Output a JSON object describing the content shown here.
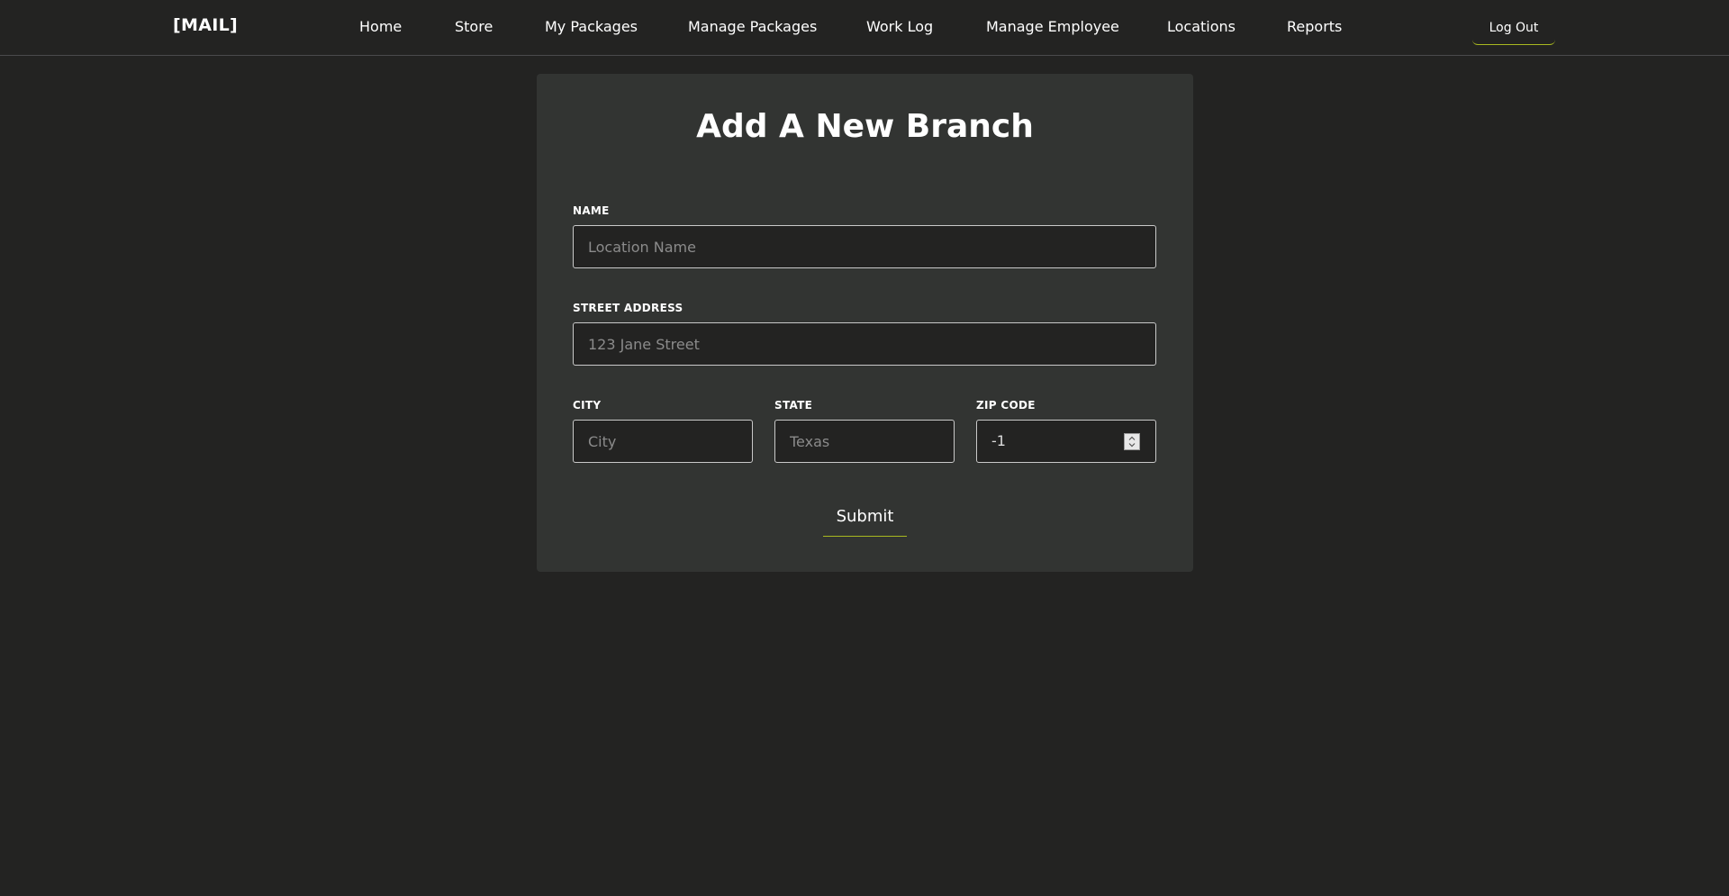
{
  "brand": "[MAIL]",
  "nav": {
    "home": "Home",
    "store": "Store",
    "my_packages": "My Packages",
    "manage_packages": "Manage Packages",
    "work_log": "Work Log",
    "manage_employee": "Manage Employee",
    "locations": "Locations",
    "reports": "Reports",
    "logout": "Log Out"
  },
  "form": {
    "title": "Add A New Branch",
    "name": {
      "label": "NAME",
      "placeholder": "Location Name",
      "value": ""
    },
    "street": {
      "label": "STREET ADDRESS",
      "placeholder": "123 Jane Street",
      "value": ""
    },
    "city": {
      "label": "CITY",
      "placeholder": "City",
      "value": ""
    },
    "state": {
      "label": "STATE",
      "placeholder": "Texas",
      "value": ""
    },
    "zip": {
      "label": "ZIP CODE",
      "value": "-1",
      "spinner_icon": "number-stepper-icon"
    },
    "submit_label": "Submit"
  },
  "colors": {
    "background": "#232322",
    "card": "#323432",
    "accent_underline": "#a8b820",
    "text": "#ffffff",
    "placeholder": "#8b8b8b"
  }
}
